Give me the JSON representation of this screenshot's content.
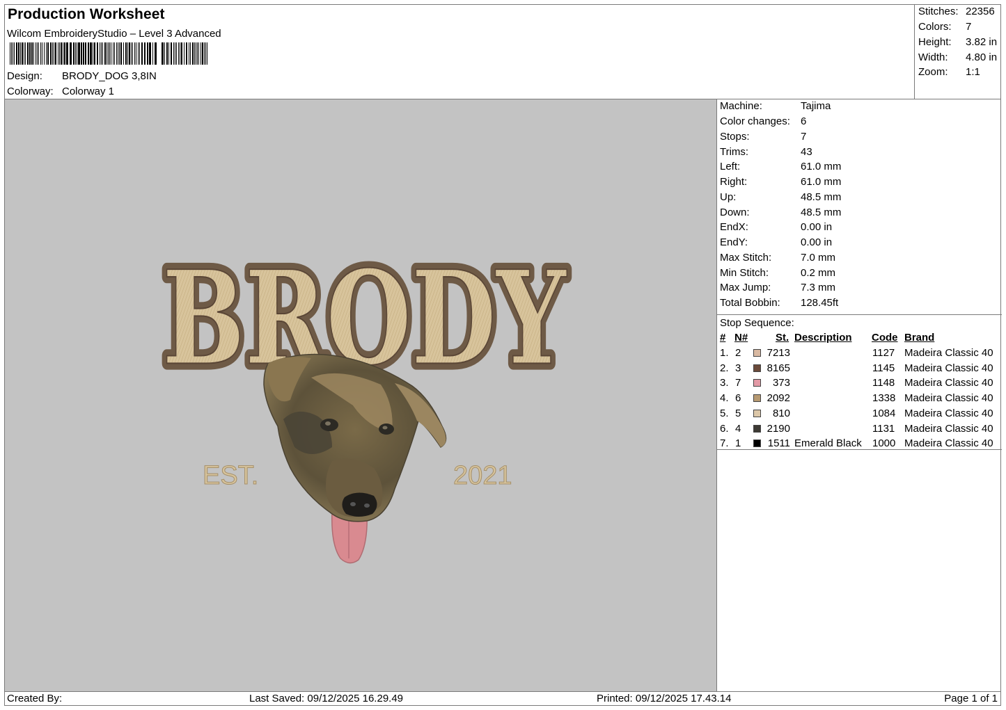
{
  "header": {
    "title": "Production Worksheet",
    "software": "Wilcom EmbroideryStudio – Level 3 Advanced",
    "design_label": "Design:",
    "design_value": "BRODY_DOG 3,8IN",
    "colorway_label": "Colorway:",
    "colorway_value": "Colorway 1"
  },
  "stats": [
    {
      "label": "Stitches:",
      "value": "22356"
    },
    {
      "label": "Colors:",
      "value": "7"
    },
    {
      "label": "Height:",
      "value": "3.82 in"
    },
    {
      "label": "Width:",
      "value": "4.80 in"
    },
    {
      "label": "Zoom:",
      "value": "1:1"
    }
  ],
  "machine_info": [
    {
      "label": "Machine:",
      "value": "Tajima"
    },
    {
      "label": "Color changes:",
      "value": "6"
    },
    {
      "label": "Stops:",
      "value": "7"
    },
    {
      "label": "Trims:",
      "value": "43"
    },
    {
      "label": "Left:",
      "value": "61.0 mm"
    },
    {
      "label": "Right:",
      "value": "61.0 mm"
    },
    {
      "label": "Up:",
      "value": "48.5 mm"
    },
    {
      "label": "Down:",
      "value": "48.5 mm"
    },
    {
      "label": "EndX:",
      "value": "0.00 in"
    },
    {
      "label": "EndY:",
      "value": "0.00 in"
    },
    {
      "label": "Max Stitch:",
      "value": "7.0 mm"
    },
    {
      "label": "Min Stitch:",
      "value": "0.2 mm"
    },
    {
      "label": "Max Jump:",
      "value": "7.3 mm"
    },
    {
      "label": "Total Bobbin:",
      "value": "128.45ft"
    }
  ],
  "stop_sequence": {
    "title": "Stop Sequence:",
    "columns": {
      "num": "#",
      "n": "N#",
      "st": "St.",
      "description": "Description",
      "code": "Code",
      "brand": "Brand"
    },
    "rows": [
      {
        "num": "1.",
        "n": "2",
        "color": "#d9b9a2",
        "st": "7213",
        "description": "",
        "code": "1127",
        "brand": "Madeira Classic 40"
      },
      {
        "num": "2.",
        "n": "3",
        "color": "#6b4a3a",
        "st": "8165",
        "description": "",
        "code": "1145",
        "brand": "Madeira Classic 40"
      },
      {
        "num": "3.",
        "n": "7",
        "color": "#e39aa6",
        "st": "373",
        "description": "",
        "code": "1148",
        "brand": "Madeira Classic 40"
      },
      {
        "num": "4.",
        "n": "6",
        "color": "#b79a72",
        "st": "2092",
        "description": "",
        "code": "1338",
        "brand": "Madeira Classic 40"
      },
      {
        "num": "5.",
        "n": "5",
        "color": "#dcc7a8",
        "st": "810",
        "description": "",
        "code": "1084",
        "brand": "Madeira Classic 40"
      },
      {
        "num": "6.",
        "n": "4",
        "color": "#3d3a34",
        "st": "2190",
        "description": "",
        "code": "1131",
        "brand": "Madeira Classic 40"
      },
      {
        "num": "7.",
        "n": "1",
        "color": "#000000",
        "st": "1511",
        "description": "Emerald Black",
        "code": "1000",
        "brand": "Madeira Classic 40"
      }
    ]
  },
  "design_preview": {
    "name_text": "BRODY",
    "est_text": "EST.",
    "year_text": "2021"
  },
  "footer": {
    "created_by": "Created By:",
    "last_saved": "Last Saved: 09/12/2025 16.29.49",
    "printed": "Printed: 09/12/2025 17.43.14",
    "page": "Page 1 of 1"
  }
}
